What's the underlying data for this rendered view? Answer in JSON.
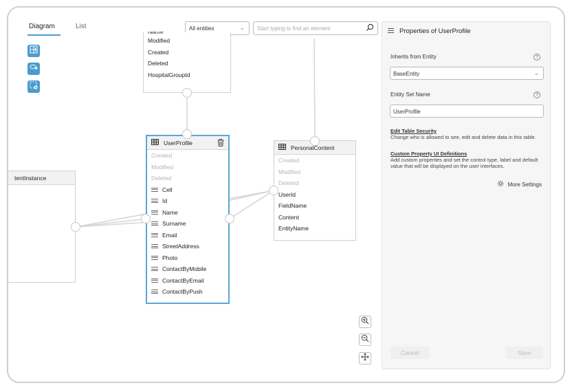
{
  "tabs": [
    {
      "label": "Diagram",
      "active": true
    },
    {
      "label": "List",
      "active": false
    }
  ],
  "filter": {
    "value": "All entities"
  },
  "search": {
    "placeholder": "Start typing to find an element"
  },
  "tools": [
    "add-entity-icon",
    "add-relation-icon",
    "add-selection-icon"
  ],
  "entities": {
    "top": {
      "rows": [
        "Name",
        "Modified",
        "Created",
        "Deleted",
        "HospitalGroupId"
      ]
    },
    "left": {
      "title": "tentInstance"
    },
    "userprofile": {
      "title": "UserProfile",
      "system_rows": [
        "Created",
        "Modified",
        "Deleted"
      ],
      "rows": [
        "Cell",
        "Id",
        "Name",
        "Surname",
        "Email",
        "StreetAddress",
        "Photo",
        "ContactByMobile",
        "ContactByEmail",
        "ContactByPush"
      ]
    },
    "personalcontent": {
      "title": "PersonalContent",
      "system_rows": [
        "Created",
        "Modified",
        "Deleted"
      ],
      "rows": [
        "UserId",
        "FieldName",
        "Content",
        "EntityName"
      ]
    }
  },
  "zoom_controls": [
    "zoom-in-icon",
    "zoom-out-icon",
    "fit-view-icon"
  ],
  "panel": {
    "title": "Properties of UserProfile",
    "inherits_label": "Inherits from Entity",
    "inherits_value": "BaseEntity",
    "entity_set_label": "Entity Set Name",
    "entity_set_value": "UserProfile",
    "help_glyph": "?",
    "security_link": "Edit Table Security",
    "security_desc": "Change who is allowed to see, edit and delete data in this table.",
    "custom_link": "Custom Property UI Definitions",
    "custom_desc": "Add custom properties and set the control type, label and default value that will be displayed on the user interfaces.",
    "more_settings": "More Settings",
    "cancel": "Cancel",
    "save": "Save"
  },
  "colors": {
    "accent": "#4a9ccf",
    "selected_border": "#5aa6d6",
    "link_line": "#d6d6d6"
  }
}
